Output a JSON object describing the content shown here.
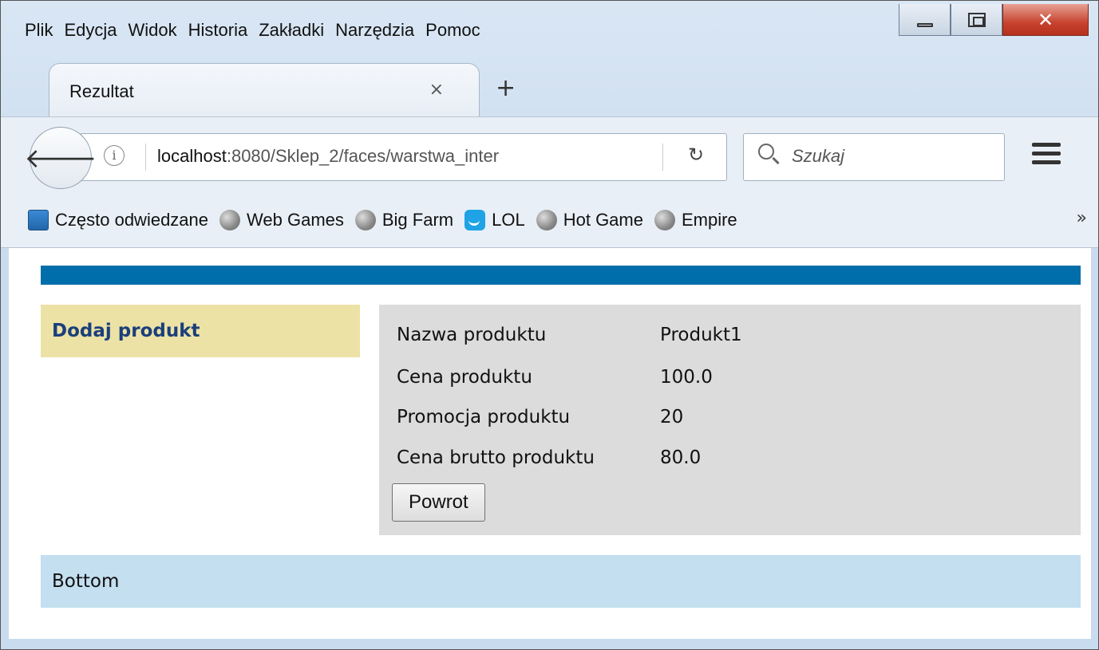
{
  "menu": [
    "Plik",
    "Edycja",
    "Widok",
    "Historia",
    "Zakładki",
    "Narzędzia",
    "Pomoc"
  ],
  "tab": {
    "title": "Rezultat",
    "close": "×",
    "new": "+"
  },
  "nav": {
    "url_host": "localhost",
    "url_rest": ":8080/Sklep_2/faces/warstwa_inter",
    "search_placeholder": "Szukaj"
  },
  "bookmarks": [
    "Często odwiedzane",
    "Web Games",
    "Big Farm",
    "LOL",
    "Hot Game",
    "Empire"
  ],
  "page": {
    "left_title": "Dodaj produkt",
    "rows": [
      {
        "label": "Nazwa produktu",
        "value": "Produkt1"
      },
      {
        "label": "Cena produktu",
        "value": "100.0"
      },
      {
        "label": "Promocja produktu",
        "value": "20"
      },
      {
        "label": "Cena brutto produktu",
        "value": "80.0"
      }
    ],
    "button": "Powrot",
    "bottom": "Bottom"
  },
  "colors": {
    "topbar": "#006eaa",
    "left_panel": "#ece2a6",
    "content_panel": "#dcdcdc",
    "bottom_bar": "#c3dff0"
  }
}
